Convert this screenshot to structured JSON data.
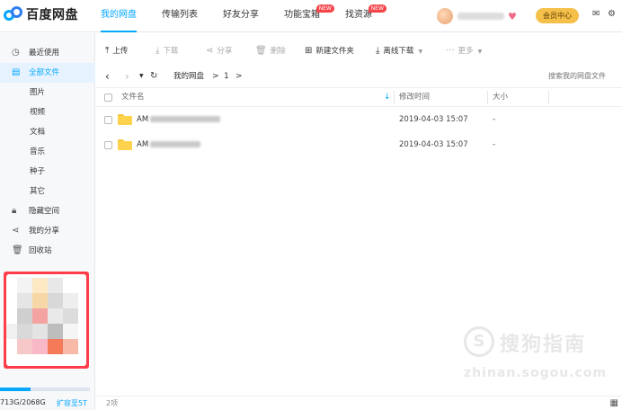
{
  "app": {
    "logo_text": "百度网盘"
  },
  "nav": [
    {
      "label": "我的网盘",
      "active": true,
      "badge": ""
    },
    {
      "label": "传输列表",
      "active": false,
      "badge": ""
    },
    {
      "label": "好友分享",
      "active": false,
      "badge": ""
    },
    {
      "label": "功能宝箱",
      "active": false,
      "badge": "NEW"
    },
    {
      "label": "找资源",
      "active": false,
      "badge": "NEW"
    }
  ],
  "header": {
    "vip_button": "会员中心"
  },
  "sidebar": {
    "items": [
      {
        "label": "最近使用",
        "icon": "clock-icon"
      },
      {
        "label": "全部文件",
        "icon": "document-icon",
        "active": true
      },
      {
        "label": "图片"
      },
      {
        "label": "视频"
      },
      {
        "label": "文档"
      },
      {
        "label": "音乐"
      },
      {
        "label": "种子"
      },
      {
        "label": "其它"
      },
      {
        "label": "隐藏空间",
        "icon": "lock-icon"
      },
      {
        "label": "我的分享",
        "icon": "share-icon"
      },
      {
        "label": "回收站",
        "icon": "trash-icon"
      }
    ],
    "quota": {
      "text": "713G/2068G",
      "used_fraction": 0.34,
      "upgrade_link": "扩容至5T"
    }
  },
  "toolbar": {
    "upload": "上传",
    "download": "下载",
    "share": "分享",
    "delete": "删除",
    "new_folder": "新建文件夹",
    "offline_download": "离线下载",
    "more": "更多"
  },
  "pathbar": {
    "root": "我的网盘",
    "sep1": ">",
    "current": "1",
    "sep2": ">",
    "search_placeholder": "搜索我的网盘文件"
  },
  "table": {
    "headers": {
      "name": "文件名",
      "modified": "修改时间",
      "size": "大小"
    },
    "rows": [
      {
        "name_prefix": "AM",
        "modified": "2019-04-03 15:07",
        "size": "-"
      },
      {
        "name_prefix": "AM",
        "modified": "2019-04-03 15:07",
        "size": "-"
      }
    ]
  },
  "footer": {
    "count": "2项"
  },
  "watermark": {
    "cn": "搜狗指南",
    "en": "zhinan.sogou.com",
    "logo": "S"
  },
  "colors": {
    "accent": "#06a7ff",
    "vip": "#f5c04a",
    "badge": "#f5454a",
    "folder": "#ffd24d"
  }
}
